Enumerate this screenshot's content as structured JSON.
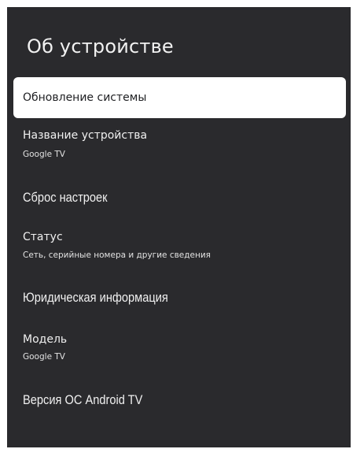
{
  "page": {
    "title": "Об устройстве"
  },
  "menu": {
    "items": [
      {
        "label": "Обновление системы",
        "sub": "",
        "focused": true
      },
      {
        "label": "Название устройства",
        "sub": "Google TV",
        "focused": false
      },
      {
        "label": "Сброс настроек",
        "sub": "",
        "focused": false
      },
      {
        "label": "Статус",
        "sub": "Сеть, серийные номера и другие сведения",
        "focused": false
      },
      {
        "label": "Юридическая информация",
        "sub": "",
        "focused": false
      },
      {
        "label": "Модель",
        "sub": "Google TV",
        "focused": false
      },
      {
        "label": "Версия ОС Android TV",
        "sub": "",
        "focused": false
      }
    ]
  },
  "colors": {
    "panel_background": "#2a2a2d",
    "focused_background": "#ffffff",
    "text_primary": "#f0f0f0",
    "text_focused": "#202124"
  }
}
